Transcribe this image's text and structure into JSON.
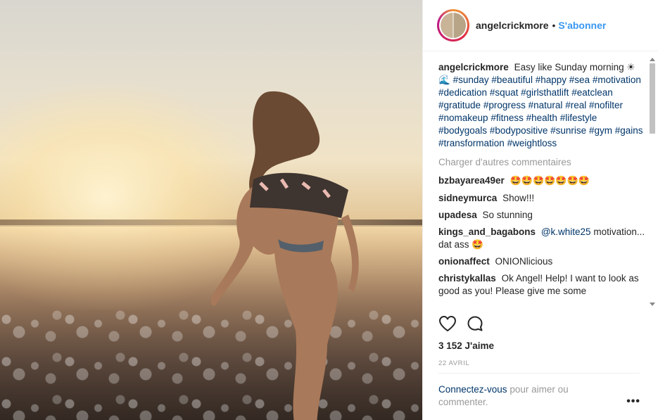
{
  "header": {
    "username": "angelcrickmore",
    "separator": "•",
    "follow_label": "S'abonner"
  },
  "caption": {
    "username": "angelcrickmore",
    "text": "Easy like Sunday morning ☀🌊",
    "hashtags": [
      "#sunday",
      "#beautiful",
      "#happy",
      "#sea",
      "#motivation",
      "#dedication",
      "#squat",
      "#girlsthatlift",
      "#eatclean",
      "#gratitude",
      "#progress",
      "#natural",
      "#real",
      "#nofilter",
      "#nomakeup",
      "#fitness",
      "#health",
      "#lifestyle",
      "#bodygoals",
      "#bodypositive",
      "#sunrise",
      "#gym",
      "#gains",
      "#transformation",
      "#weightloss"
    ]
  },
  "load_more_label": "Charger d'autres commentaires",
  "comments": [
    {
      "username": "bzbayarea49er",
      "text": "🤩🤩🤩🤩🤩🤩🤩"
    },
    {
      "username": "sidneymurca",
      "text": "Show!!!"
    },
    {
      "username": "upadesa",
      "text": "So stunning"
    },
    {
      "username": "kings_and_bagabons",
      "mention": "@k.white25",
      "text": "motivation... dat ass 🤩"
    },
    {
      "username": "onionaffect",
      "text": "ONIONlicious"
    },
    {
      "username": "christykallas",
      "text": "Ok Angel! Help! I want to look as good as you! Please give me some"
    }
  ],
  "stats": {
    "likes": "3 152 J'aime",
    "date": "22 AVRIL"
  },
  "login_prompt": {
    "link": "Connectez-vous",
    "text": "pour aimer ou commenter."
  },
  "more_label": "•••",
  "icons": {
    "like": "heart-icon",
    "comment": "comment-icon"
  },
  "colors": {
    "accent": "#3897f0",
    "link": "#003569",
    "muted": "#999999"
  }
}
